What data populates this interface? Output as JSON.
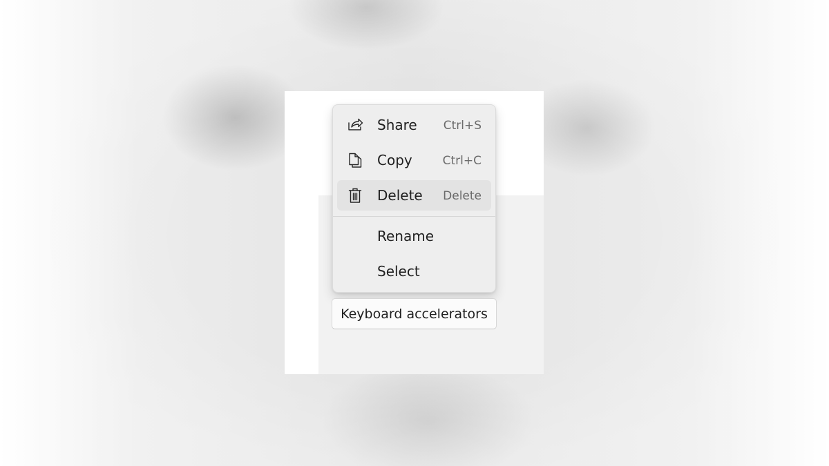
{
  "menu": {
    "items": [
      {
        "label": "Share",
        "accelerator": "Ctrl+S",
        "icon": "share-icon"
      },
      {
        "label": "Copy",
        "accelerator": "Ctrl+C",
        "icon": "copy-icon"
      },
      {
        "label": "Delete",
        "accelerator": "Delete",
        "icon": "delete-icon"
      },
      {
        "label": "Rename"
      },
      {
        "label": "Select"
      }
    ]
  },
  "button": {
    "label": "Keyboard accelerators"
  },
  "colors": {
    "menu_background": "#eeeeee",
    "highlight": "#e3e3e3",
    "text": "#1f1f1f",
    "accelerator_text": "#6b6b6b"
  }
}
